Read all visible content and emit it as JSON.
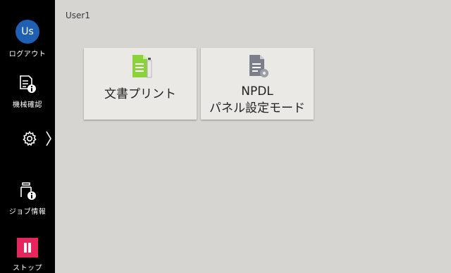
{
  "sidebar": {
    "avatar_initials": "Us",
    "logout_label": "ログアウト",
    "machine_check_label": "機械確認",
    "job_info_label": "ジョブ情報",
    "stop_label": "ストップ",
    "stop_color": "#e5275e",
    "avatar_color": "#1f5fb4"
  },
  "header": {
    "user": "User1"
  },
  "tiles": [
    {
      "label": "文書プリント",
      "icon": "document-print-icon",
      "icon_color": "#8cd23c"
    },
    {
      "label_line1": "NPDL",
      "label_line2": "パネル設定モード",
      "icon": "document-settings-icon",
      "icon_color": "#7b7f8a"
    }
  ]
}
